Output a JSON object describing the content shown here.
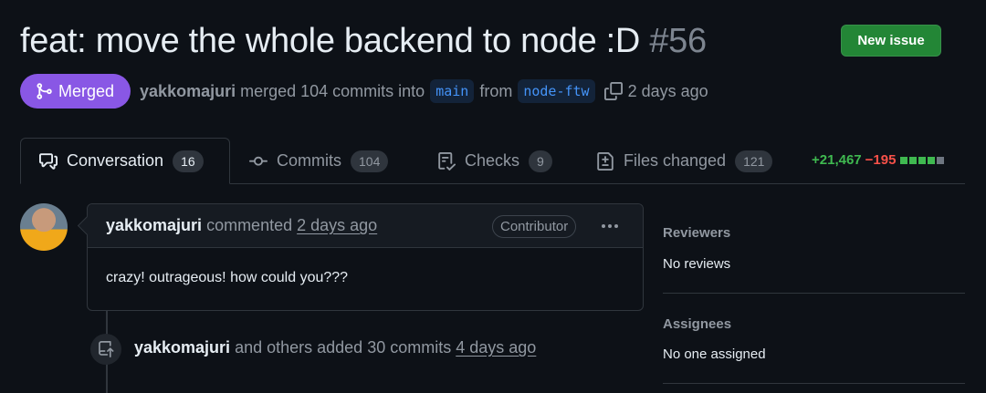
{
  "header": {
    "title": "feat: move the whole backend to node :D",
    "number": "#56",
    "new_issue_label": "New issue"
  },
  "status": {
    "state_label": "Merged",
    "author": "yakkomajuri",
    "merge_text": "merged 104 commits into",
    "base_branch": "main",
    "from_text": "from",
    "head_branch": "node-ftw",
    "time": "2 days ago"
  },
  "tabs": [
    {
      "label": "Conversation",
      "count": "16",
      "icon": "comment-discussion-icon",
      "active": true
    },
    {
      "label": "Commits",
      "count": "104",
      "icon": "git-commit-icon"
    },
    {
      "label": "Checks",
      "count": "9",
      "icon": "checklist-icon"
    },
    {
      "label": "Files changed",
      "count": "121",
      "icon": "file-diff-icon"
    }
  ],
  "diffstat": {
    "additions": "+21,467",
    "deletions": "−195",
    "blocks": [
      "green",
      "green",
      "green",
      "green",
      "gray"
    ],
    "colors": {
      "add": "#3fb950",
      "del": "#f85149"
    }
  },
  "comment": {
    "author": "yakkomajuri",
    "action": "commented",
    "time": "2 days ago",
    "badge": "Contributor",
    "body": "crazy! outrageous! how could you???"
  },
  "event": {
    "author": "yakkomajuri",
    "text": "and others added 30 commits",
    "time": "4 days ago"
  },
  "sidebar": {
    "reviewers_label": "Reviewers",
    "reviewers_value": "No reviews",
    "assignees_label": "Assignees",
    "assignees_value": "No one assigned"
  },
  "colors": {
    "merged": "#8957e5",
    "new_issue": "#238636",
    "branch": "#4493f8"
  }
}
